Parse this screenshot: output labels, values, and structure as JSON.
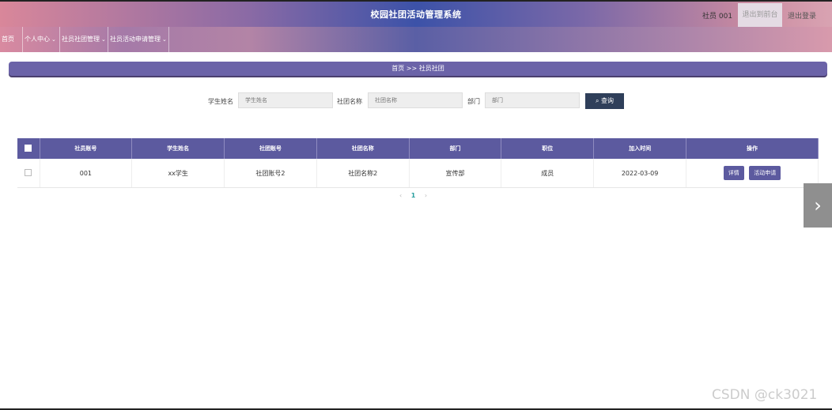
{
  "header": {
    "title": "校园社团活动管理系统",
    "user": "社员 001",
    "front_label": "退出到前台",
    "logout_label": "退出登录"
  },
  "nav": {
    "home": "首页",
    "items": [
      "个人中心",
      "社员社团管理",
      "社员活动申请管理"
    ]
  },
  "breadcrumb": "首页 >> 社员社团",
  "search": {
    "student_label": "学生姓名",
    "student_placeholder": "学生姓名",
    "club_label": "社团名称",
    "club_placeholder": "社团名称",
    "dept_label": "部门",
    "dept_placeholder": "部门",
    "query_label": "查询"
  },
  "table": {
    "columns": [
      "社员账号",
      "学生姓名",
      "社团账号",
      "社团名称",
      "部门",
      "职位",
      "加入时间",
      "操作"
    ],
    "rows": [
      [
        "001",
        "xx学生",
        "社团账号2",
        "社团名称2",
        "宣传部",
        "成员",
        "2022-03-09"
      ]
    ],
    "actions": [
      "详情",
      "活动申请"
    ]
  },
  "pager": {
    "prev": "‹",
    "current": "1",
    "next": "›"
  },
  "watermark": "CSDN @ck3021"
}
